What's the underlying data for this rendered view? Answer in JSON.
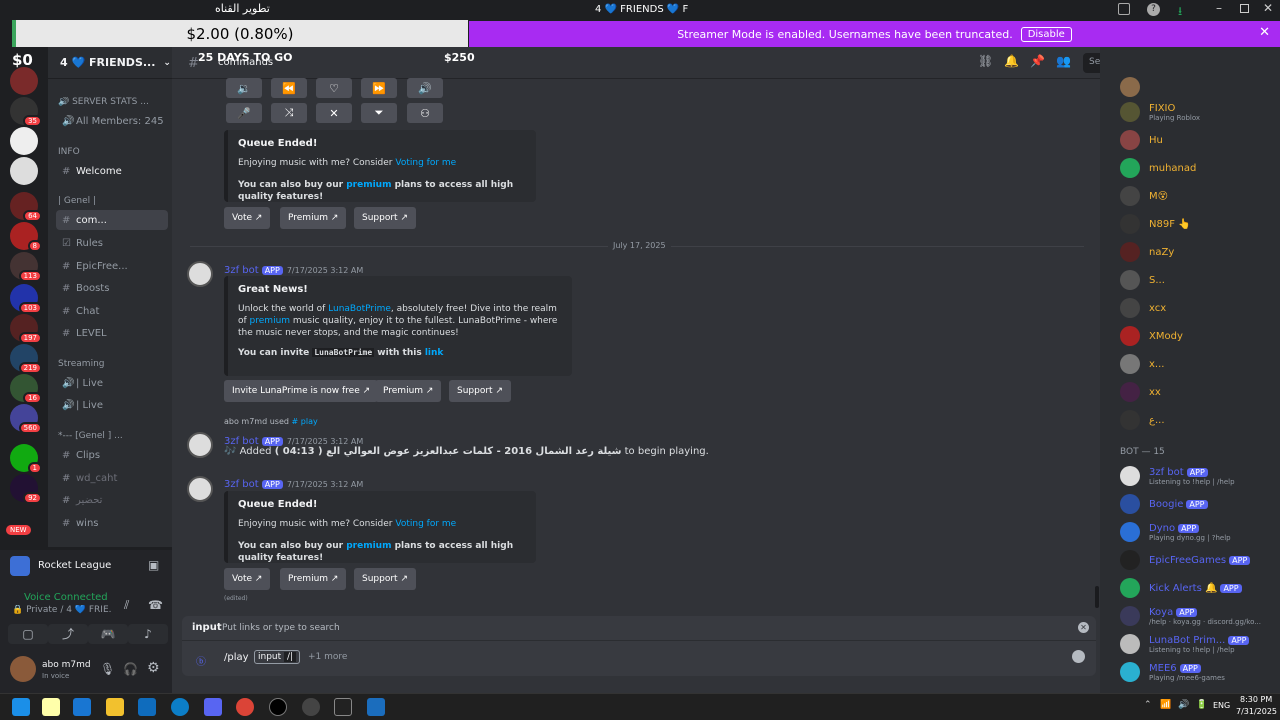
{
  "overlay": {
    "amount": "$2.00 (0.80%)",
    "left_value": "$0",
    "days_to_go": "25 DAYS TO GO",
    "goal": "$250",
    "top_title": "تطوير القناه"
  },
  "window": {
    "title": "4 💙 FRIENDS 💙 F"
  },
  "streamer_banner": {
    "text": "Streamer Mode is enabled. Usernames have been truncated.",
    "button": "Disable"
  },
  "server": {
    "name": "4 💙 FRIENDS..."
  },
  "header": {
    "channel": "commands",
    "search_placeholder": "Search"
  },
  "channels": {
    "cat_server_stats": "SERVER STATS ...",
    "all_members": "All Members: 245",
    "cat_info": "INFO",
    "welcome": "Welcome",
    "cat_genel": "| Genel |",
    "commands": "com...",
    "rules": "Rules",
    "epicfree": "EpicFree...",
    "boosts": "Boosts",
    "chat": "Chat",
    "level": "LEVEL",
    "cat_streaming": "Streaming",
    "live1": "| Live",
    "live2": "| Live",
    "cat_genel2": "*--- [Genel ] ...",
    "clips": "Clips",
    "wd_caht": "wd_caht",
    "tahdeer": "تحضير",
    "wins": "wins",
    "new_badge": "NEW"
  },
  "server_badges": [
    "35",
    "64",
    "8",
    "113",
    "103",
    "197",
    "219",
    "16",
    "560",
    "1",
    "92"
  ],
  "activity": {
    "game": "Rocket League"
  },
  "voice": {
    "status": "Voice Connected",
    "channel": "Private / 4 💙 FRIE..."
  },
  "user": {
    "name": "abo m7md",
    "status": "In voice"
  },
  "messages": [
    {
      "embed_title": "Queue Ended!",
      "line1_pre": "Enjoying music with me? Consider ",
      "line1_link": "Voting for me",
      "line2_pre": "You can also buy our ",
      "line2_link": "premium",
      "line2_post": " plans to access all high quality features!",
      "buttons": [
        "Vote",
        "Premium",
        "Support"
      ]
    },
    {
      "date_divider": "July 17, 2025"
    },
    {
      "author": "3zf bot",
      "badge": "APP",
      "time": "7/17/2025 3:12 AM",
      "embed_title": "Great News!",
      "desc_pre": "Unlock the world of ",
      "desc_link1": "LunaBotPrime",
      "desc_mid": ", absolutely free! Dive into the realm of ",
      "desc_link2": "premium",
      "desc_post": " music quality, enjoy it to the fullest. LunaBotPrime - where the music never stops, and the magic continues!",
      "invite_pre": "You can invite ",
      "invite_code": "LunaBotPrime",
      "invite_mid": " with this ",
      "invite_link": "link",
      "buttons": [
        "Invite LunaPrime is now free",
        "Premium",
        "Support"
      ]
    },
    {
      "reply_user": "abo m7md",
      "reply_used": "used",
      "reply_cmd": "play",
      "author": "3zf bot",
      "badge": "APP",
      "time": "7/17/2025 3:12 AM",
      "text_pre": "Added ",
      "text_bold": "( 04:13 ) شيلة رعد الشمال 2016 - كلمات عبدالعزيز عوض العوالي الع",
      "text_post": " to begin playing."
    },
    {
      "author": "3zf bot",
      "badge": "APP",
      "time": "7/17/2025 3:12 AM",
      "embed_title": "Queue Ended!",
      "line1_pre": "Enjoying music with me? Consider ",
      "line1_link": "Voting for me",
      "line2_pre": "You can also buy our ",
      "line2_link": "premium",
      "line2_post": " plans to access all high quality features!",
      "buttons": [
        "Vote",
        "Premium",
        "Support"
      ],
      "edited": "(edited)"
    }
  ],
  "input": {
    "label": "input",
    "hint": "Put links or type to search",
    "command": "/play",
    "option": "input",
    "more": "+1 more"
  },
  "members": [
    {
      "name": "FIXIO",
      "sub": "Playing Roblox",
      "color": "#f0b232"
    },
    {
      "name": "Hu",
      "sub": "",
      "color": "#f0b232"
    },
    {
      "name": "muhanad",
      "sub": "",
      "color": "#f0b232"
    },
    {
      "name": "M😵",
      "sub": "",
      "color": "#f0b232"
    },
    {
      "name": "N89F 👆",
      "sub": "",
      "color": "#f0b232"
    },
    {
      "name": "naZy",
      "sub": "",
      "color": "#f0b232"
    },
    {
      "name": "S...",
      "sub": "",
      "color": "#f0b232"
    },
    {
      "name": "xcx",
      "sub": "",
      "color": "#f0b232"
    },
    {
      "name": "XModу",
      "sub": "",
      "color": "#f0b232"
    },
    {
      "name": "x...",
      "sub": "",
      "color": "#f0b232"
    },
    {
      "name": "xx",
      "sub": "",
      "color": "#f0b232"
    },
    {
      "name": "ع...",
      "sub": "",
      "color": "#f0b232"
    }
  ],
  "bot_header": "BOT — 15",
  "bots": [
    {
      "name": "3zf bot",
      "sub": "Listening to !help | /help"
    },
    {
      "name": "Boogie",
      "sub": ""
    },
    {
      "name": "Dyno",
      "sub": "Playing dyno.gg | ?help"
    },
    {
      "name": "EpicFreeGames",
      "sub": ""
    },
    {
      "name": "Kick Alerts 🔔",
      "sub": ""
    },
    {
      "name": "Koya",
      "sub": "/help · koya.gg · discord.gg/ko..."
    },
    {
      "name": "LunaBot Prim...",
      "sub": "Listening to !help | /help"
    },
    {
      "name": "MEE6",
      "sub": "Playing /mee6-games"
    }
  ],
  "taskbar": {
    "lang": "ENG",
    "time": "8:30 PM",
    "date": "7/31/2025"
  },
  "colors": {
    "accent": "#5865f2",
    "streamer": "#a82bf2",
    "link": "#00a8fc",
    "online": "#23a55a",
    "dnd": "#f23f43"
  }
}
